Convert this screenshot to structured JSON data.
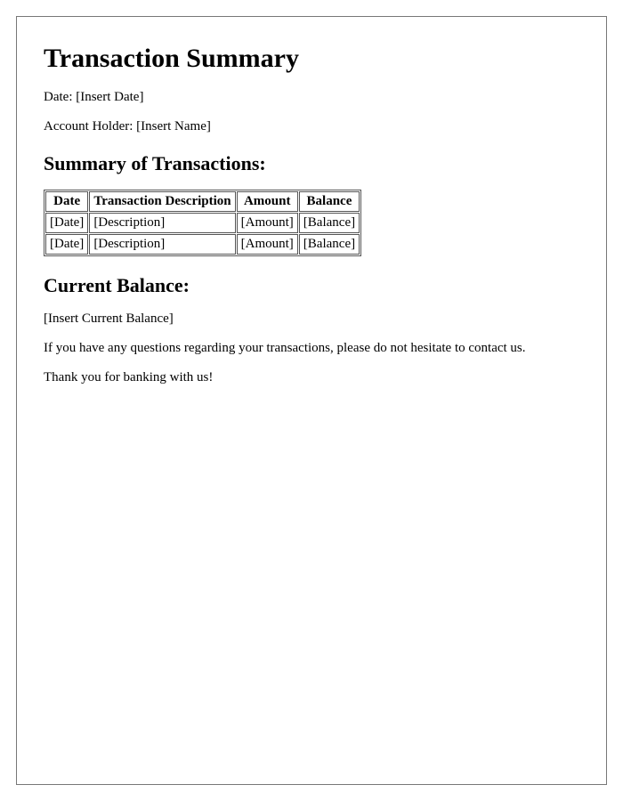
{
  "title": "Transaction Summary",
  "meta": {
    "date_label": "Date: ",
    "date_value": "[Insert Date]",
    "holder_label": "Account Holder: ",
    "holder_value": "[Insert Name]"
  },
  "summary_heading": "Summary of Transactions:",
  "table": {
    "headers": {
      "date": "Date",
      "desc": "Transaction Description",
      "amount": "Amount",
      "balance": "Balance"
    },
    "rows": [
      {
        "date": "[Date]",
        "desc": "[Description]",
        "amount": "[Amount]",
        "balance": "[Balance]"
      },
      {
        "date": "[Date]",
        "desc": "[Description]",
        "amount": "[Amount]",
        "balance": "[Balance]"
      }
    ]
  },
  "current_balance_heading": "Current Balance:",
  "current_balance_value": "[Insert Current Balance]",
  "footer_line_1": "If you have any questions regarding your transactions, please do not hesitate to contact us.",
  "footer_line_2": "Thank you for banking with us!"
}
